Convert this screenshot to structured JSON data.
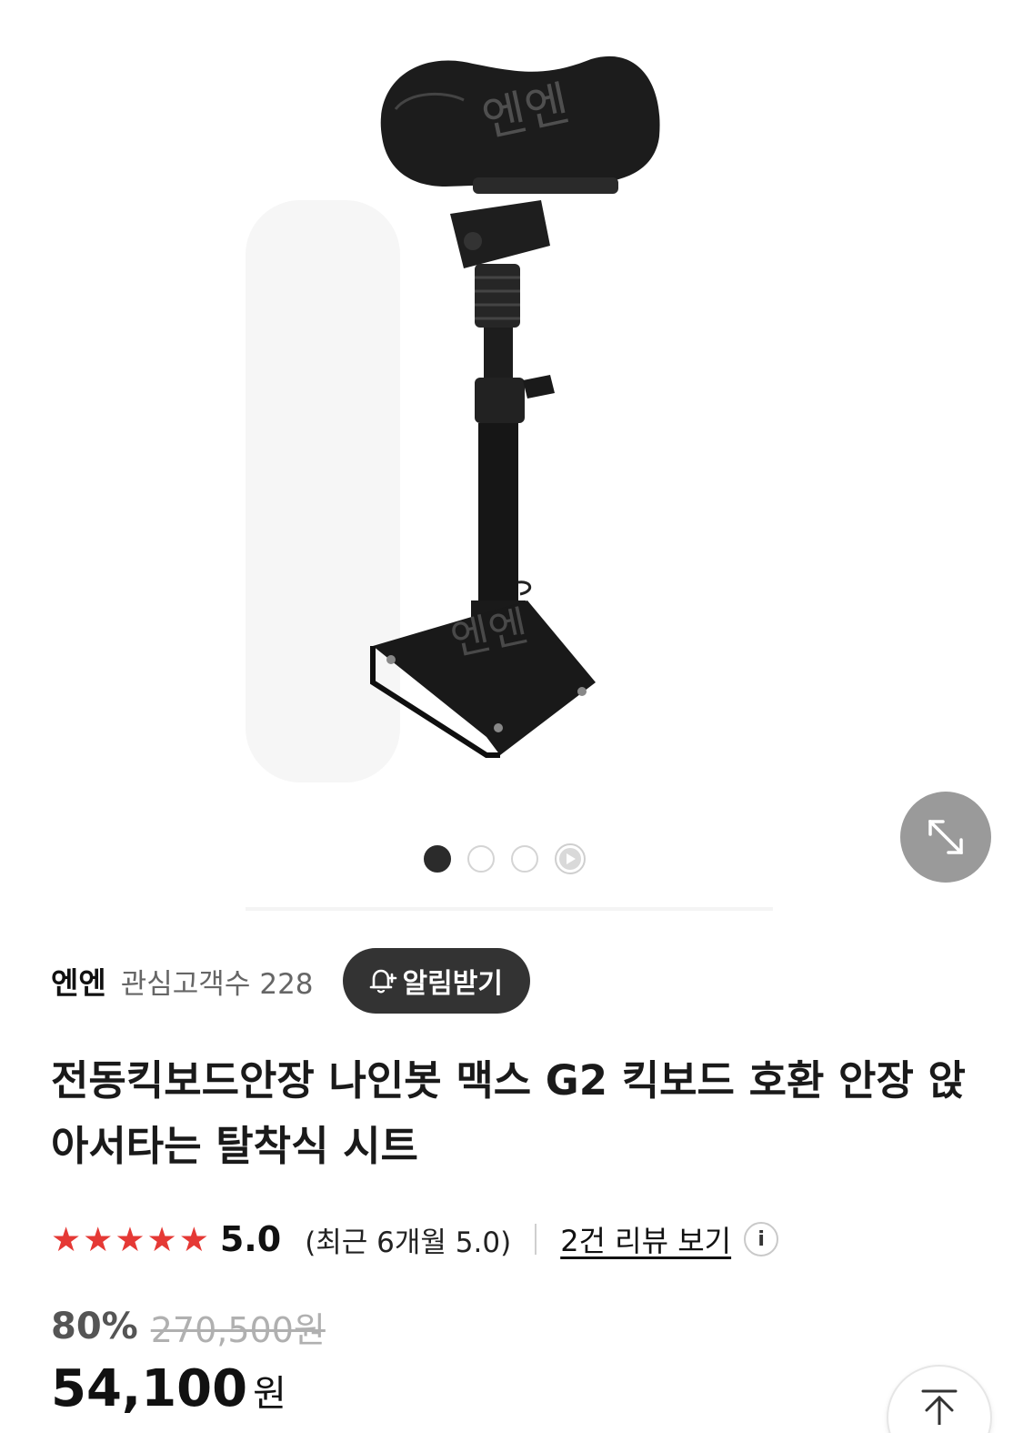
{
  "gallery": {
    "watermark": "엔엔",
    "expand_icon": "expand-diagonal-icon",
    "page_count": 4,
    "active_index": 0
  },
  "seller": {
    "name": "엔엔",
    "followers_label": "관심고객수",
    "followers_count": "228",
    "alarm_label": "알림받기",
    "alarm_icon": "bell-plus-icon"
  },
  "product": {
    "title": "전동킥보드안장 나인봇 맥스 G2 킥보드 호환 안장 앉아서타는 탈착식 시트"
  },
  "rating": {
    "stars": "★★★★★",
    "star_color": "#e53935",
    "score": "5.0",
    "recent": "(최근 6개월 5.0)",
    "review_link": "2건 리뷰 보기",
    "info_icon": "i"
  },
  "price": {
    "discount": "80%",
    "original": "270,500원",
    "sale": "54,100",
    "unit": "원"
  },
  "scroll_top_icon": "arrow-up-to-top-icon"
}
